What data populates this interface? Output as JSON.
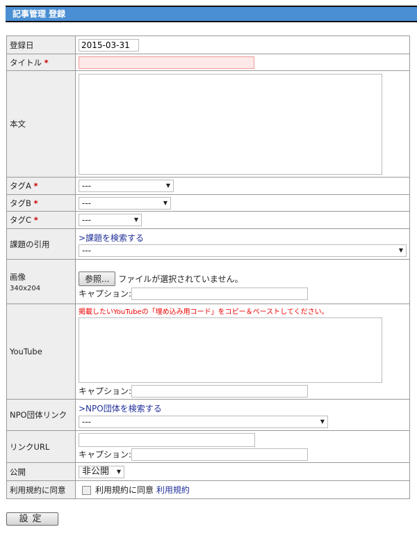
{
  "header": {
    "title": "記事管理 登録"
  },
  "required_mark": "*",
  "rows": {
    "date": {
      "label": "登録日",
      "value": "2015-03-31"
    },
    "title": {
      "label": "タイトル",
      "value": ""
    },
    "body": {
      "label": "本文"
    },
    "tagA": {
      "label": "タグA",
      "selected": "---"
    },
    "tagB": {
      "label": "タグB",
      "selected": "---"
    },
    "tagC": {
      "label": "タグC",
      "selected": "---"
    },
    "issue": {
      "label": "課題の引用",
      "link": ">課題を検索する",
      "selected": "---"
    },
    "image": {
      "label": "画像",
      "size": "340x204",
      "browse": "参照...",
      "no_file": "ファイルが選択されていません。",
      "caption_label": "キャプション:"
    },
    "youtube": {
      "label": "YouTube",
      "note": "掲載したいYouTubeの「埋め込み用コード」をコピー＆ペーストしてください。",
      "caption_label": "キャプション:"
    },
    "npo": {
      "label": "NPO団体リンク",
      "link": ">NPO団体を検索する",
      "selected": "---"
    },
    "link_url": {
      "label": "リンクURL",
      "caption_label": "キャプション:"
    },
    "publish": {
      "label": "公開",
      "selected": "非公開"
    },
    "terms": {
      "label": "利用規約に同意",
      "checkbox_label": "利用規約に同意",
      "link": "利用規約",
      "checked": false
    }
  },
  "submit": "設定"
}
